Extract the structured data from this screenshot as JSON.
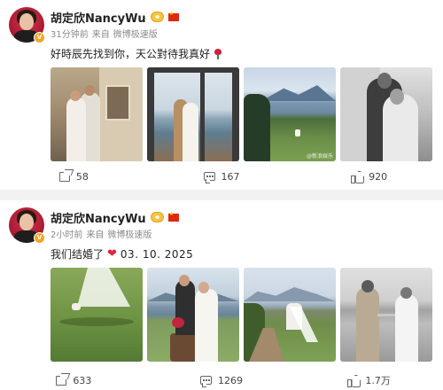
{
  "posts": [
    {
      "author": "胡定欣NancyWu",
      "time": "31分钟前",
      "source_prefix": "来自",
      "source": "微博极速版",
      "text": "好時辰先找到你，天公對待我真好",
      "stats": {
        "shares": "58",
        "comments": "167",
        "likes": "920"
      },
      "watermark": "@新浪娱乐"
    },
    {
      "author": "胡定欣NancyWu",
      "time": "2小时前",
      "source_prefix": "来自",
      "source": "微博极速版",
      "text": "我们结婚了",
      "date": "03. 10. 2025",
      "stats": {
        "shares": "633",
        "comments": "1269",
        "likes": "1.7万"
      }
    }
  ],
  "colors": {
    "heart": "#e0243a",
    "rose": "#d31f3b",
    "vip": "#f6c343",
    "flag": "#de2910"
  }
}
